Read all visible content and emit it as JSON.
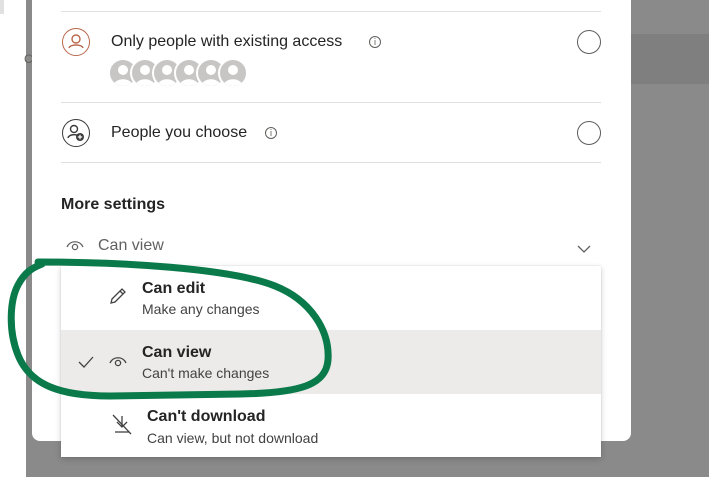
{
  "left_strip": {
    "letter": "C"
  },
  "sharing_options": [
    {
      "label": "Only people with existing access",
      "info_icon": "info-icon",
      "selected": false
    },
    {
      "label": "People you choose",
      "info_icon": "info-icon",
      "selected": false
    }
  ],
  "info_glyph": "i",
  "more_settings": {
    "title": "More settings",
    "current_permission": "Can view"
  },
  "permission_menu": [
    {
      "title": "Can edit",
      "subtitle": "Make any changes",
      "icon": "pencil-icon",
      "selected": false
    },
    {
      "title": "Can view",
      "subtitle": "Can't make changes",
      "icon": "eye-icon",
      "selected": true
    },
    {
      "title": "Can't download",
      "subtitle": "Can view, but not download",
      "icon": "no-download-icon",
      "selected": false
    }
  ],
  "colors": {
    "annotation": "#0b7a4b",
    "selected_bg": "#edebe9",
    "existing_access_icon": "#b9674b"
  }
}
